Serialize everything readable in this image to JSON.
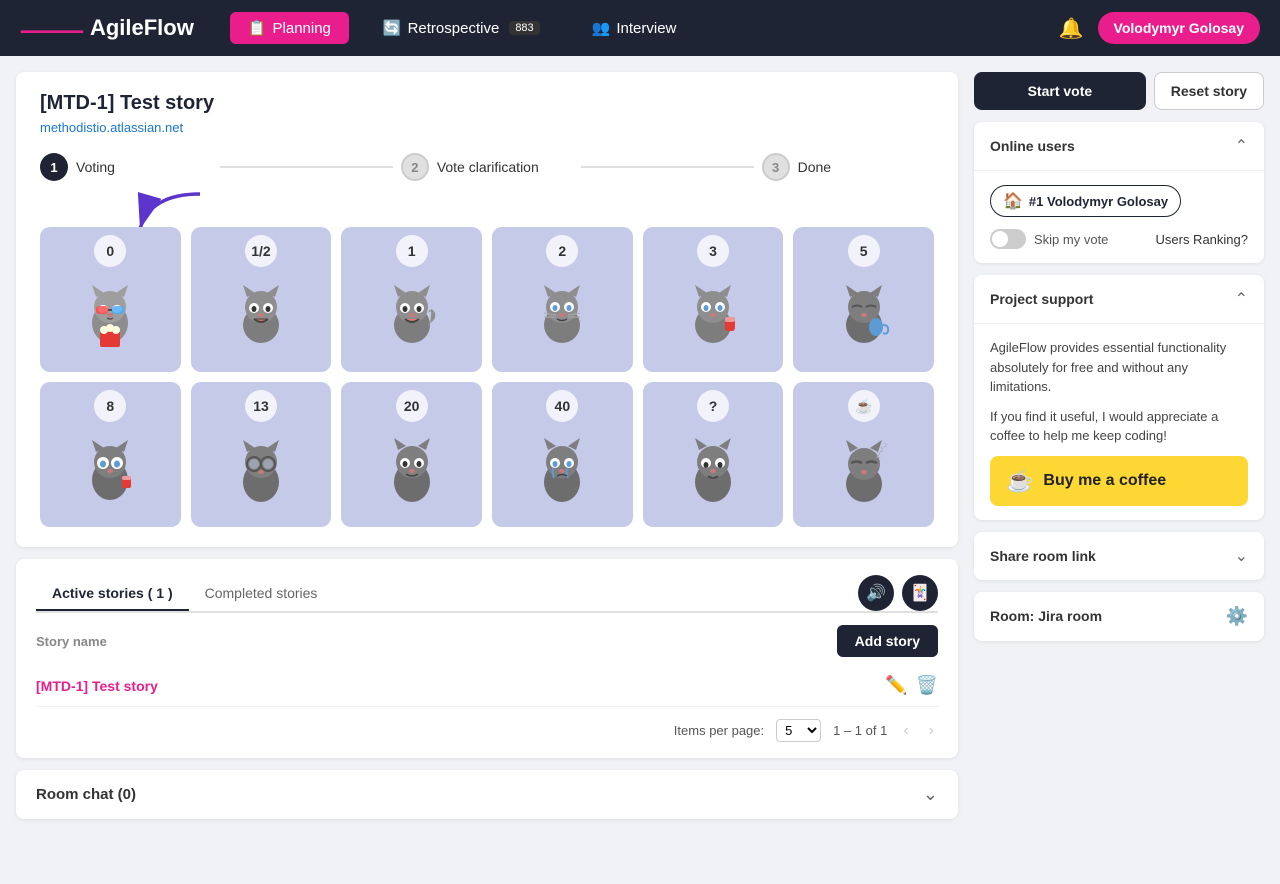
{
  "navbar": {
    "logo": "AgileFlow",
    "planning_label": "Planning",
    "retrospective_label": "Retrospective",
    "interview_label": "Interview",
    "user_label": "Volodymyr Golosay",
    "retro_badge": "883"
  },
  "story": {
    "title": "[MTD-1] Test story",
    "link": "methodistio.atlassian.net"
  },
  "steps": [
    {
      "number": "1",
      "label": "Voting",
      "active": true
    },
    {
      "number": "2",
      "label": "Vote clarification",
      "active": false
    },
    {
      "number": "3",
      "label": "Done",
      "active": false
    }
  ],
  "cards": [
    {
      "value": "0",
      "emoji": "🐱"
    },
    {
      "value": "1/2",
      "emoji": "🐱"
    },
    {
      "value": "1",
      "emoji": "🐱"
    },
    {
      "value": "2",
      "emoji": "🐱"
    },
    {
      "value": "3",
      "emoji": "🐱"
    },
    {
      "value": "5",
      "emoji": "🐱"
    },
    {
      "value": "8",
      "emoji": "🐱"
    },
    {
      "value": "13",
      "emoji": "🐱"
    },
    {
      "value": "20",
      "emoji": "🐱"
    },
    {
      "value": "40",
      "emoji": "🐱"
    },
    {
      "value": "?",
      "emoji": "🐱"
    },
    {
      "value": "☕",
      "emoji": "🐱"
    }
  ],
  "stories_section": {
    "active_tab": "Active stories",
    "active_count": "1",
    "completed_tab": "Completed stories",
    "column_label": "Story name",
    "add_btn": "Add story",
    "story_row_name": "[MTD-1] Test story",
    "pagination": {
      "items_per_page": "Items per page:",
      "per_page_value": "5",
      "range": "1 – 1 of 1"
    }
  },
  "chat": {
    "title": "Room chat (0)"
  },
  "right_panel": {
    "start_vote": "Start vote",
    "reset_story": "Reset story",
    "online_users": {
      "title": "Online users",
      "user_badge": "#1 Volodymyr Golosay",
      "skip_vote": "Skip my vote",
      "users_ranking": "Users Ranking?"
    },
    "project_support": {
      "title": "Project support",
      "text1": "AgileFlow provides essential functionality absolutely for free and without any limitations.",
      "text2": "If you find it useful, I would appreciate a coffee to help me keep coding!",
      "buy_coffee": "Buy me a coffee"
    },
    "share_room": {
      "title": "Share room link"
    },
    "room": {
      "title": "Room: Jira room"
    }
  }
}
